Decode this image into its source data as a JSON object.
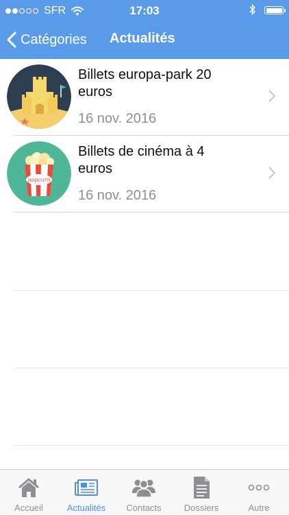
{
  "status_bar": {
    "carrier": "SFR",
    "time": "17:03"
  },
  "nav": {
    "back_label": "Catégories",
    "title": "Actualités"
  },
  "items": [
    {
      "title": "Billets europa-park 20 euros",
      "date": "16 nov. 2016",
      "icon": "sandcastle-icon"
    },
    {
      "title": "Billets de cinéma à 4 euros",
      "date": "16 nov. 2016",
      "icon": "popcorn-icon",
      "icon_text": "popcorn"
    }
  ],
  "tabs": [
    {
      "label": "Accueil",
      "icon": "home-icon",
      "active": false
    },
    {
      "label": "Actualités",
      "icon": "news-icon",
      "active": true
    },
    {
      "label": "Contacts",
      "icon": "contacts-icon",
      "active": false
    },
    {
      "label": "Dossiers",
      "icon": "document-icon",
      "active": false
    },
    {
      "label": "Autre",
      "icon": "more-icon",
      "active": false
    }
  ],
  "colors": {
    "nav_bar": "#5a9be9",
    "active_tab": "#4a90e2",
    "inactive_tab": "#8e8e93"
  }
}
